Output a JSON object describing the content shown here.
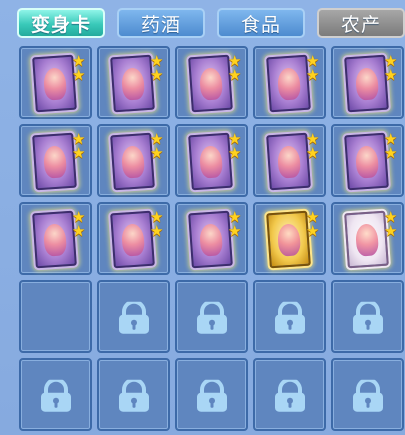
{
  "tabs": [
    {
      "label": "变身卡",
      "active": true
    },
    {
      "label": "药酒",
      "active": false
    },
    {
      "label": "食品",
      "active": false
    },
    {
      "label": "农产",
      "active": false
    }
  ],
  "slots": [
    {
      "type": "card",
      "style": "purple",
      "stars": 2
    },
    {
      "type": "card",
      "style": "purple",
      "stars": 2
    },
    {
      "type": "card",
      "style": "purple",
      "stars": 2
    },
    {
      "type": "card",
      "style": "purple",
      "stars": 2
    },
    {
      "type": "card",
      "style": "purple",
      "stars": 2
    },
    {
      "type": "card",
      "style": "purple",
      "stars": 2
    },
    {
      "type": "card",
      "style": "purple",
      "stars": 2
    },
    {
      "type": "card",
      "style": "purple",
      "stars": 2
    },
    {
      "type": "card",
      "style": "purple",
      "stars": 2
    },
    {
      "type": "card",
      "style": "purple",
      "stars": 2
    },
    {
      "type": "card",
      "style": "purple",
      "stars": 2
    },
    {
      "type": "card",
      "style": "purple",
      "stars": 2
    },
    {
      "type": "card",
      "style": "purple",
      "stars": 2
    },
    {
      "type": "card",
      "style": "gold",
      "stars": 2
    },
    {
      "type": "card",
      "style": "white",
      "stars": 2
    },
    {
      "type": "empty"
    },
    {
      "type": "locked"
    },
    {
      "type": "locked"
    },
    {
      "type": "locked"
    },
    {
      "type": "locked"
    },
    {
      "type": "locked"
    },
    {
      "type": "locked"
    },
    {
      "type": "locked"
    },
    {
      "type": "locked"
    },
    {
      "type": "locked"
    }
  ],
  "colors": {
    "active_tab": "#39c9b9",
    "tab": "#4d8bcf",
    "disabled_tab": "#7b7b7b",
    "star": "#ffd21f",
    "slot_bg": "#5f86bf"
  }
}
